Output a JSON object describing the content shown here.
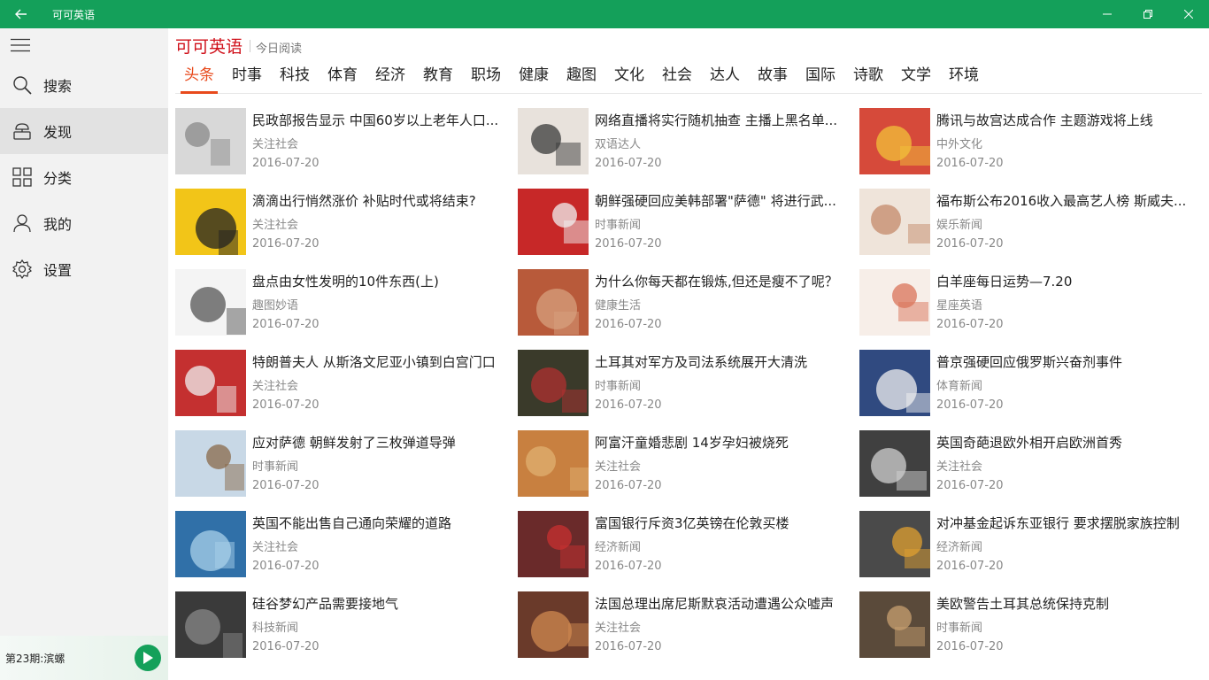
{
  "window": {
    "title": "可可英语"
  },
  "sidebar": {
    "items": [
      {
        "label": "搜索",
        "icon": "search-icon"
      },
      {
        "label": "发现",
        "icon": "discover-icon",
        "active": true
      },
      {
        "label": "分类",
        "icon": "grid-icon"
      },
      {
        "label": "我的",
        "icon": "user-icon"
      },
      {
        "label": "设置",
        "icon": "gear-icon"
      }
    ],
    "player": {
      "episode": "第23期:滨螺",
      "icon": "play-icon"
    }
  },
  "header": {
    "brand": "可可英语",
    "subtitle": "今日阅读"
  },
  "tabs": [
    "头条",
    "时事",
    "科技",
    "体育",
    "经济",
    "教育",
    "职场",
    "健康",
    "趣图",
    "文化",
    "社会",
    "达人",
    "故事",
    "国际",
    "诗歌",
    "文学",
    "环境"
  ],
  "articles": [
    {
      "title": "民政部报告显示 中国60岁以上老年人口...",
      "category": "关注社会",
      "date": "2016-07-20"
    },
    {
      "title": "网络直播将实行随机抽查 主播上黑名单...",
      "category": "双语达人",
      "date": "2016-07-20"
    },
    {
      "title": "腾讯与故宫达成合作 主题游戏将上线",
      "category": "中外文化",
      "date": "2016-07-20"
    },
    {
      "title": "滴滴出行悄然涨价 补贴时代或将结束?",
      "category": "关注社会",
      "date": "2016-07-20"
    },
    {
      "title": "朝鲜强硬回应美韩部署\"萨德\" 将进行武...",
      "category": "时事新闻",
      "date": "2016-07-20"
    },
    {
      "title": "福布斯公布2016收入最高艺人榜 斯威夫...",
      "category": "娱乐新闻",
      "date": "2016-07-20"
    },
    {
      "title": "盘点由女性发明的10件东西(上)",
      "category": "趣图妙语",
      "date": "2016-07-20"
    },
    {
      "title": "为什么你每天都在锻炼,但还是瘦不了呢？",
      "category": "健康生活",
      "date": "2016-07-20"
    },
    {
      "title": "白羊座每日运势—7.20",
      "category": "星座英语",
      "date": "2016-07-20"
    },
    {
      "title": "特朗普夫人 从斯洛文尼亚小镇到白宫门口",
      "category": "关注社会",
      "date": "2016-07-20"
    },
    {
      "title": "土耳其对军方及司法系统展开大清洗",
      "category": "时事新闻",
      "date": "2016-07-20"
    },
    {
      "title": "普京强硬回应俄罗斯兴奋剂事件",
      "category": "体育新闻",
      "date": "2016-07-20"
    },
    {
      "title": "应对萨德 朝鲜发射了三枚弹道导弹",
      "category": "时事新闻",
      "date": "2016-07-20"
    },
    {
      "title": "阿富汗童婚悲剧 14岁孕妇被烧死",
      "category": "关注社会",
      "date": "2016-07-20"
    },
    {
      "title": "英国奇葩退欧外相开启欧洲首秀",
      "category": "关注社会",
      "date": "2016-07-20"
    },
    {
      "title": "英国不能出售自己通向荣耀的道路",
      "category": "关注社会",
      "date": "2016-07-20"
    },
    {
      "title": "富国银行斥资3亿英镑在伦敦买楼",
      "category": "经济新闻",
      "date": "2016-07-20"
    },
    {
      "title": "对冲基金起诉东亚银行 要求摆脱家族控制",
      "category": "经济新闻",
      "date": "2016-07-20"
    },
    {
      "title": "硅谷梦幻产品需要接地气",
      "category": "科技新闻",
      "date": "2016-07-20"
    },
    {
      "title": "法国总理出席尼斯默哀活动遭遇公众嘘声",
      "category": "关注社会",
      "date": "2016-07-20"
    },
    {
      "title": "美欧警告土耳其总统保持克制",
      "category": "时事新闻",
      "date": "2016-07-20"
    }
  ],
  "colors": {
    "accent": "#14a05a",
    "brand": "#d0101a",
    "activeTab": "#e84a1c"
  }
}
